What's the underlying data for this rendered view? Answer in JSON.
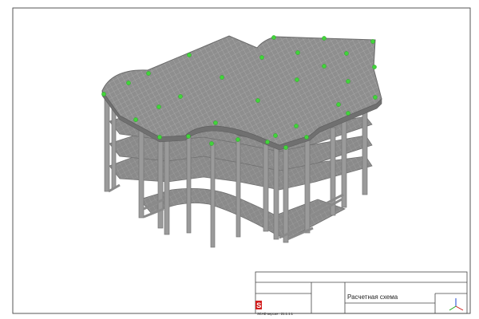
{
  "title_block": {
    "scheme_title": "Расчетная схема",
    "version_text": "SCAD версия : 21.1.1.1",
    "logo_letter": "S"
  },
  "colors": {
    "slab_fill": "#8e8e8e",
    "slab_grid": "#bdbdbd",
    "slab_side": "#6f6f6f",
    "column": "#9a9a9a",
    "column_dark": "#757575",
    "node_green": "#41d43a",
    "frame": "#444444",
    "logo_red": "#d21e1e",
    "axis_x": "#d01818",
    "axis_y": "#18a818",
    "axis_z": "#1a44d6"
  },
  "icons": {
    "logo": "scad-logo-icon",
    "axes": "coordinate-axes-icon"
  }
}
